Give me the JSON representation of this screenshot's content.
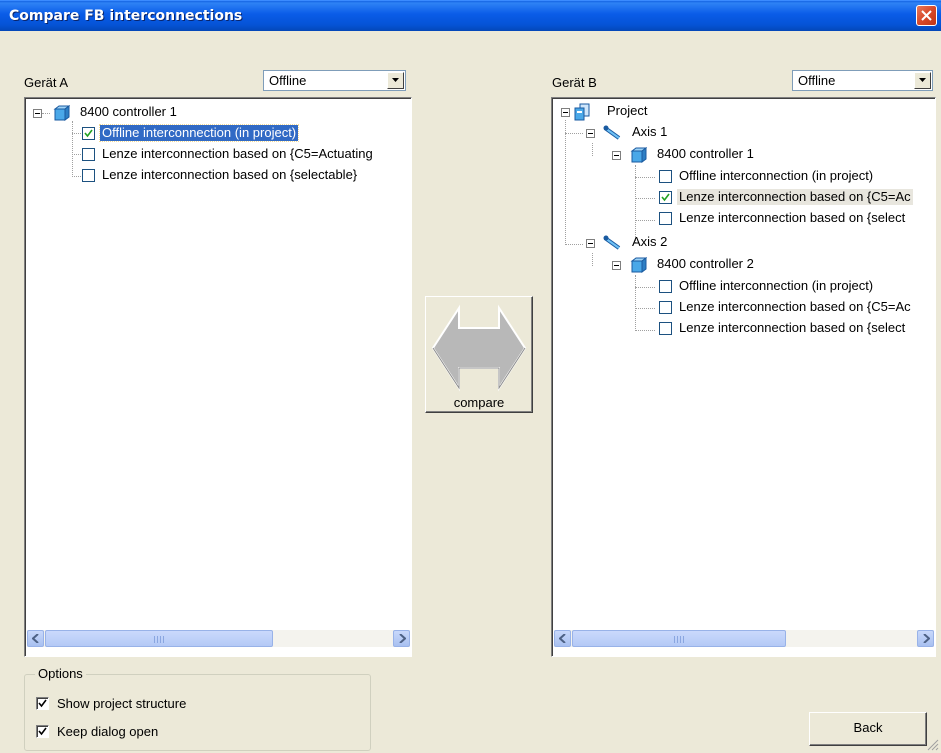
{
  "window": {
    "title": "Compare FB interconnections"
  },
  "left": {
    "label": "Gerät A",
    "mode": "Offline",
    "tree": {
      "root": "8400 controller 1",
      "items": [
        {
          "label": "Offline interconnection (in project)",
          "checked": true
        },
        {
          "label": "Lenze interconnection based on {C5=Actuating",
          "checked": false
        },
        {
          "label": "Lenze interconnection based on {selectable}",
          "checked": false
        }
      ]
    }
  },
  "right": {
    "label": "Gerät B",
    "mode": "Offline",
    "tree": {
      "root": "Project",
      "axis1": "Axis 1",
      "controller1": "8400 controller 1",
      "axis1_items": [
        {
          "label": "Offline interconnection (in project)",
          "checked": false
        },
        {
          "label": "Lenze interconnection based on {C5=Ac",
          "checked": true
        },
        {
          "label": "Lenze interconnection based on {select",
          "checked": false
        }
      ],
      "axis2": "Axis 2",
      "controller2": "8400 controller 2",
      "axis2_items": [
        {
          "label": "Offline interconnection (in project)",
          "checked": false
        },
        {
          "label": "Lenze interconnection based on {C5=Ac",
          "checked": false
        },
        {
          "label": "Lenze interconnection based on {select",
          "checked": false
        }
      ]
    }
  },
  "compare_label": "compare",
  "options": {
    "legend": "Options",
    "show_project_structure": "Show project structure",
    "keep_dialog_open": "Keep dialog open"
  },
  "back_label": "Back",
  "scroll_grip": "III"
}
